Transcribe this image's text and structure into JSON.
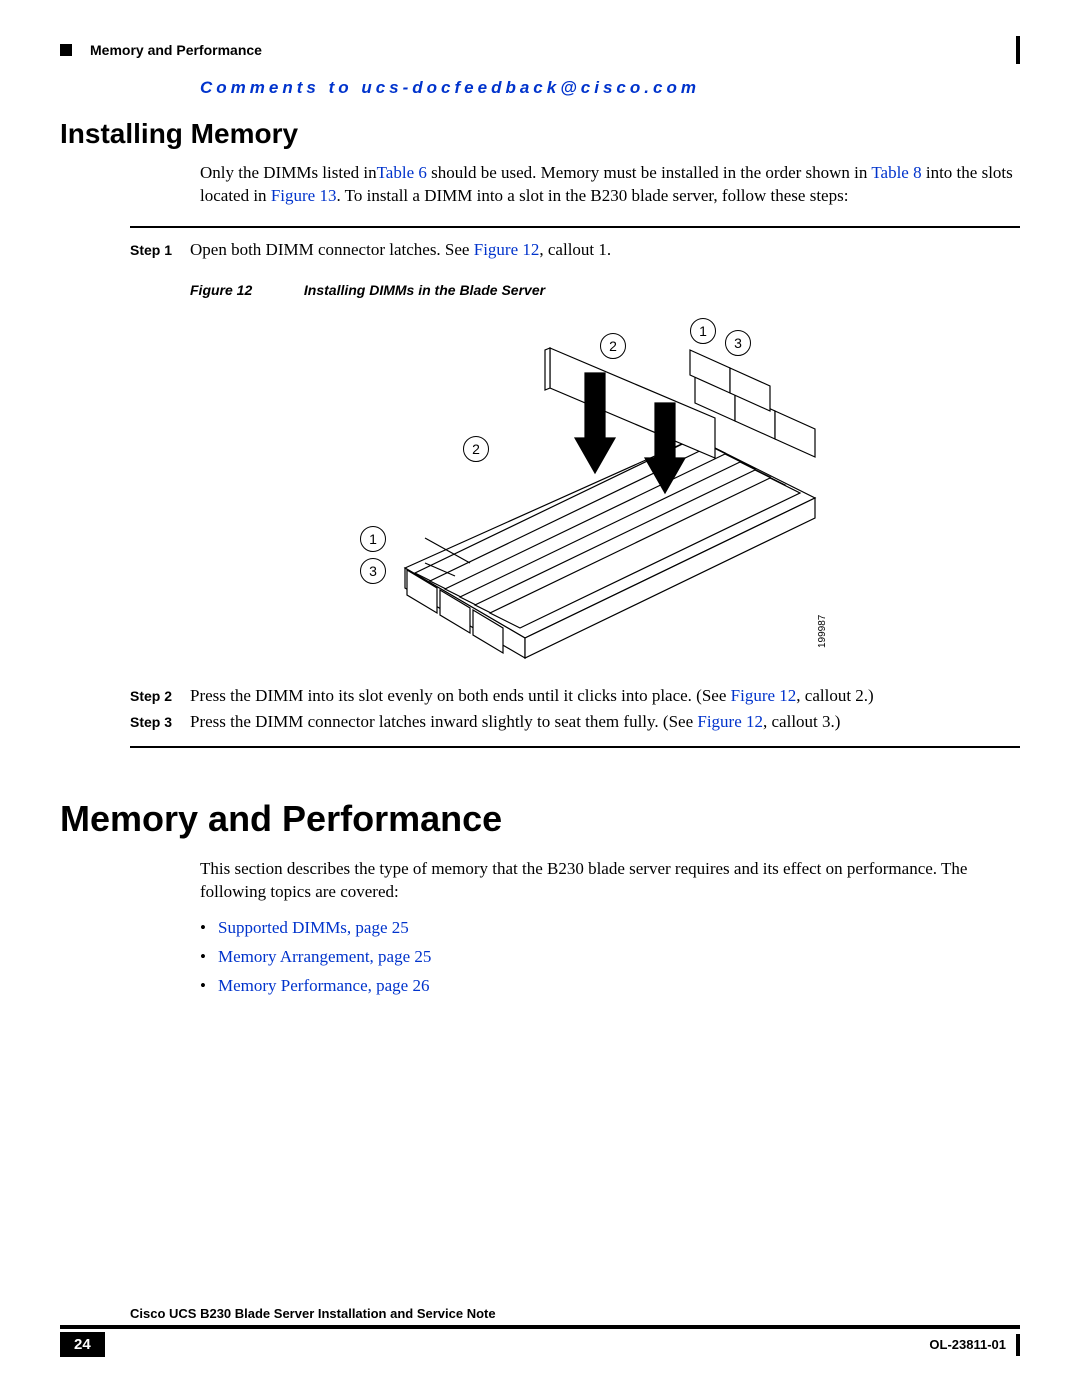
{
  "header": {
    "breadcrumb": "Memory and Performance"
  },
  "feedback_line": "Comments to ucs-docfeedback@cisco.com",
  "h2": "Installing Memory",
  "intro": {
    "p1a": "Only the DIMMs listed in",
    "link_t6": "Table 6",
    "p1b": " should be used. Memory must be installed in the order shown in ",
    "link_t8": "Table 8",
    "p1c": " into the slots located in ",
    "link_f13": "Figure 13",
    "p1d": ". To install a DIMM into a slot in the B230 blade server, follow these steps:"
  },
  "steps": {
    "s1": {
      "label": "Step 1",
      "t1": "Open both DIMM connector latches. See ",
      "link": "Figure 12",
      "t2": ", callout 1."
    },
    "s2": {
      "label": "Step 2",
      "t1": "Press the DIMM into its slot evenly on both ends until it clicks into place. (See ",
      "link": "Figure 12",
      "t2": ", callout 2.)"
    },
    "s3": {
      "label": "Step 3",
      "t1": "Press the DIMM connector latches inward slightly to seat them fully. (See ",
      "link": "Figure 12",
      "t2": ", callout 3.)"
    }
  },
  "figcap": {
    "num": "Figure 12",
    "title": "Installing DIMMs in the Blade Server"
  },
  "fignote": "199987",
  "callouts": {
    "c1": "1",
    "c2": "2",
    "c3": "3"
  },
  "h1": "Memory and Performance",
  "sect2": "This section describes the type of memory that the B230 blade server requires and its effect on performance. The following topics are covered:",
  "topics": {
    "t1": "Supported DIMMs, page 25",
    "t2": "Memory Arrangement, page 25",
    "t3": "Memory Performance, page 26"
  },
  "footer": {
    "title": "Cisco UCS B230 Blade Server Installation and Service Note",
    "page": "24",
    "doc": "OL-23811-01"
  }
}
